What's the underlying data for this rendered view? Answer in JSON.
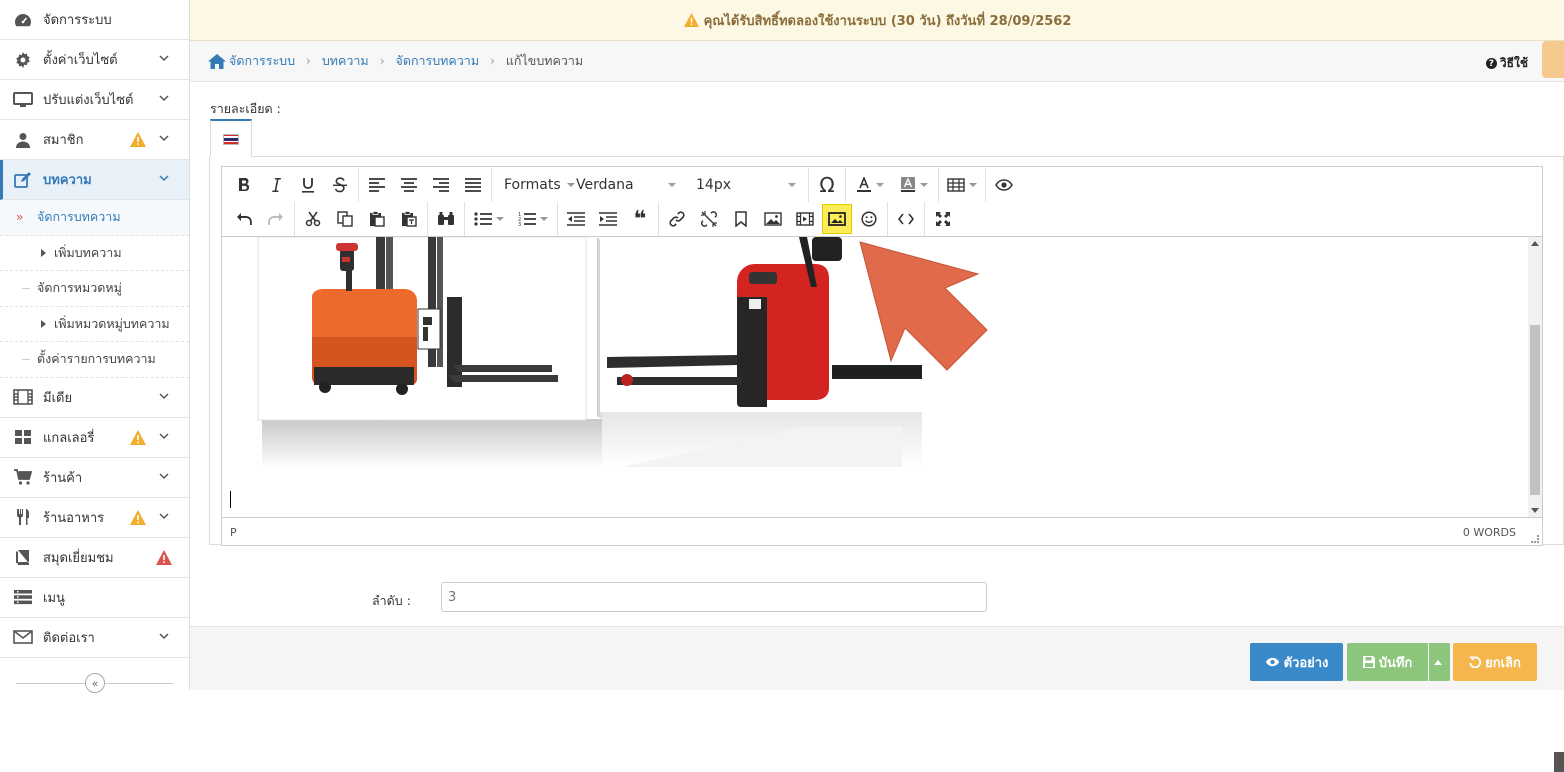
{
  "notice": {
    "text": "คุณได้รับสิทธิ์ทดลองใช้งานระบบ (30 วัน) ถึงวันที่ 28/09/2562",
    "color": "#8a6d3b",
    "background": "#fcf8e3"
  },
  "sidebar": {
    "items": [
      {
        "label": "จัดการระบบ",
        "icon": "dashboard-icon"
      },
      {
        "label": "ตั้งค่าเว็บไซต์",
        "icon": "gear-icon"
      },
      {
        "label": "ปรับแต่งเว็บไซต์",
        "icon": "monitor-icon"
      },
      {
        "label": "สมาชิก",
        "icon": "user-icon"
      },
      {
        "label": "บทความ",
        "icon": "edit-icon"
      },
      {
        "label": "มีเดีย",
        "icon": "film-icon"
      },
      {
        "label": "แกลเลอรี่",
        "icon": "grid-icon"
      },
      {
        "label": "ร้านค้า",
        "icon": "cart-icon"
      },
      {
        "label": "ร้านอาหาร",
        "icon": "utensils-icon"
      },
      {
        "label": "สมุดเยี่ยมชม",
        "icon": "book-icon"
      },
      {
        "label": "เมนู",
        "icon": "list-icon"
      },
      {
        "label": "ติดต่อเรา",
        "icon": "envelope-icon"
      }
    ],
    "sub_items": [
      {
        "label": "จัดการบทความ"
      },
      {
        "label": "เพิ่มบทความ"
      },
      {
        "label": "จัดการหมวดหมู่"
      },
      {
        "label": "เพิ่มหมวดหมู่บทความ"
      },
      {
        "label": "ตั้งค่ารายการบทความ"
      }
    ],
    "collapse_glyph": "«",
    "accent": "#337ab7"
  },
  "breadcrumb": {
    "home": "จัดการระบบ",
    "items": [
      "บทความ",
      "จัดการบทความ"
    ],
    "current": "แก้ไขบทความ",
    "separator": "›"
  },
  "help": {
    "label": "วิธีใช้",
    "glyph": "?"
  },
  "form": {
    "detail_label": "รายละเอียด :",
    "order_label": "ลำดับ :",
    "order_value": "3"
  },
  "editor": {
    "format_label": "Formats",
    "font_label": "Verdana",
    "size_label": "14px",
    "omega_glyph": "Ω",
    "quote_glyph": "❝",
    "path_label": "P",
    "word_count": "0 WORDS"
  },
  "buttons": {
    "preview": "ตัวอย่าง",
    "save": "บันทึก",
    "cancel": "ยกเลิก"
  },
  "colors": {
    "preview": "#3a89c9",
    "save": "#8cc57c",
    "cancel": "#f6b64e",
    "highlight": "#fcec58",
    "arrow": "#e06a4a"
  }
}
